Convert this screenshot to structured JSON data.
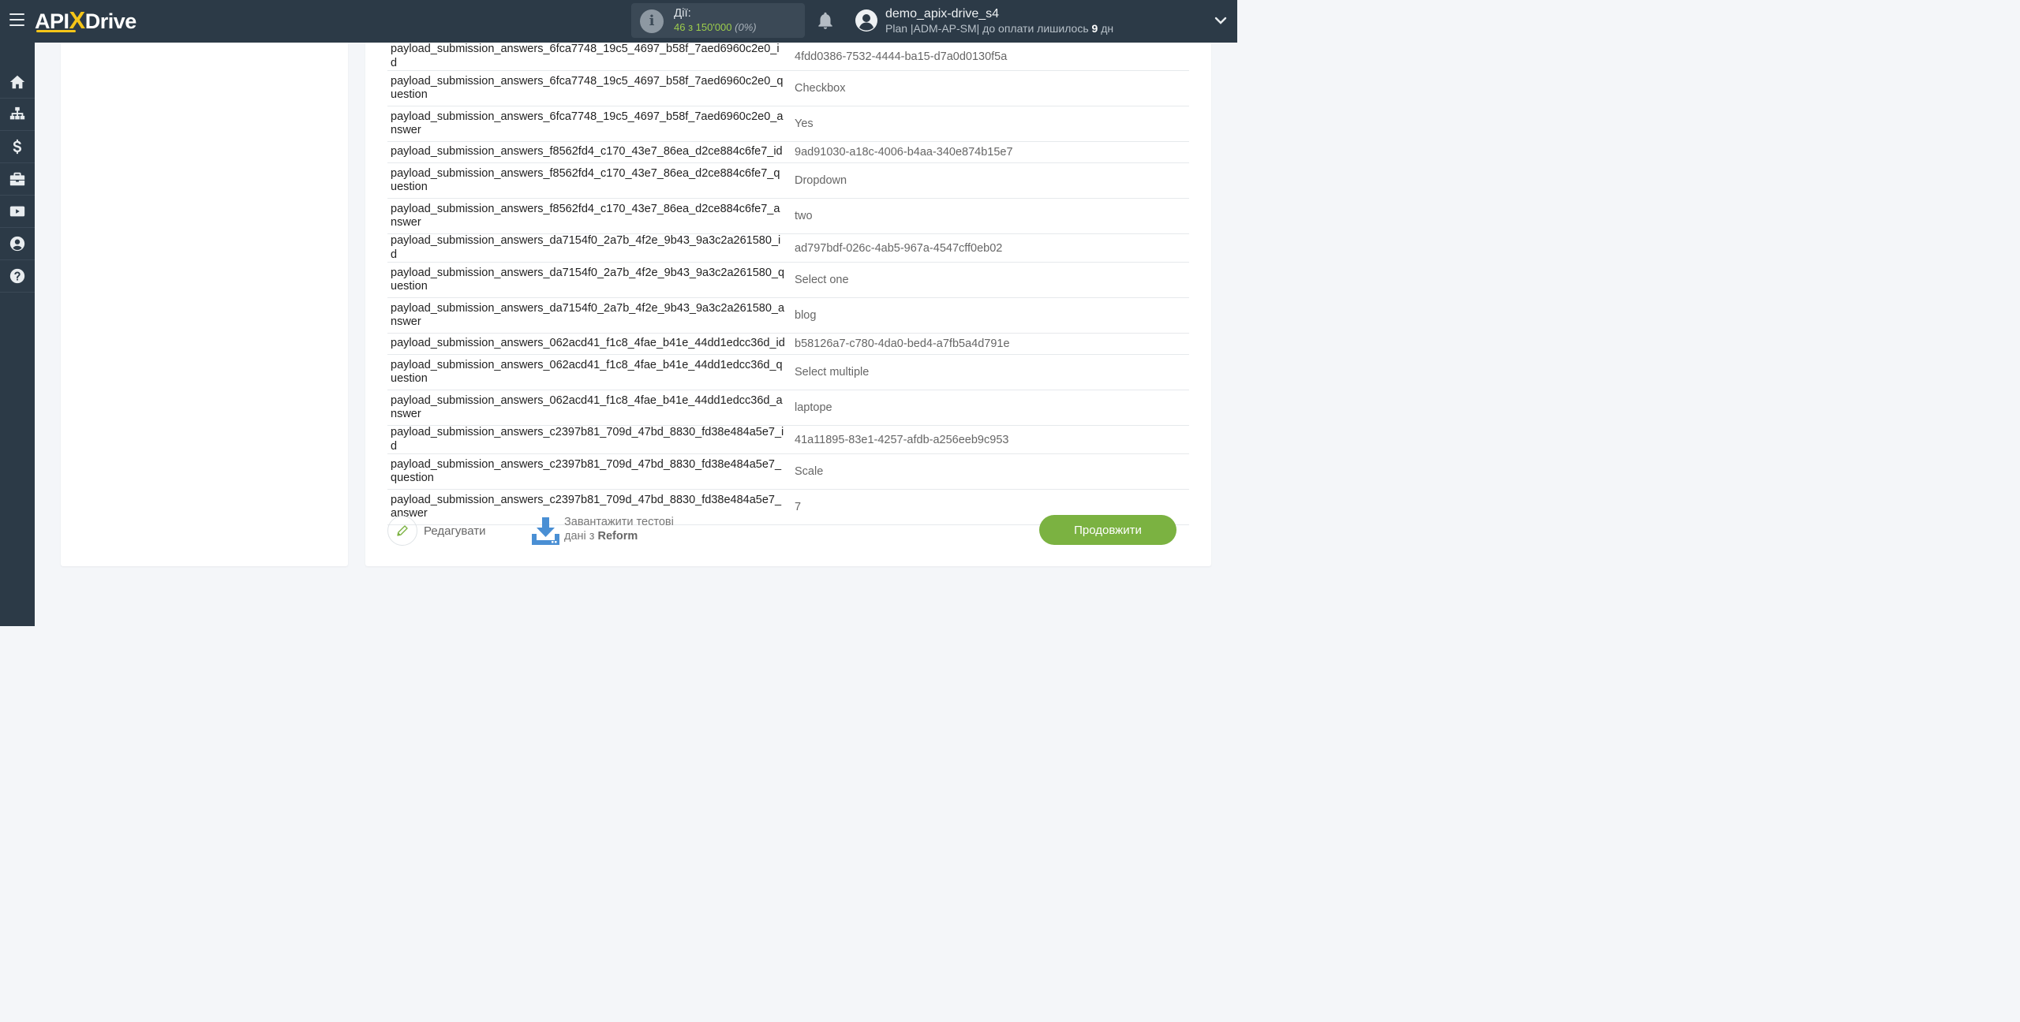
{
  "header": {
    "logo": {
      "left": "API",
      "x": "X",
      "right": "Drive"
    },
    "actions": {
      "label": "Дії:",
      "count": "46 з 150'000",
      "percent": "(0%)"
    },
    "user": {
      "name": "demo_apix-drive_s4",
      "plan_prefix": "Plan |ADM-AP-SM| до оплати лишилось ",
      "days": "9",
      "days_suffix": " дн"
    }
  },
  "sidebar": {
    "items": [
      "home-icon",
      "sitemap-icon",
      "dollar-icon",
      "briefcase-icon",
      "youtube-icon",
      "user-icon",
      "help-icon"
    ]
  },
  "table": {
    "rows": [
      {
        "key": "payload_submission_answers_6fca7748_19c5_4697_b58f_7aed6960c2e0_id",
        "value": "4fdd0386-7532-4444-ba15-d7a0d0130f5a"
      },
      {
        "key": "payload_submission_answers_6fca7748_19c5_4697_b58f_7aed6960c2e0_question",
        "value": "Checkbox"
      },
      {
        "key": "payload_submission_answers_6fca7748_19c5_4697_b58f_7aed6960c2e0_answer",
        "value": "Yes"
      },
      {
        "key": "payload_submission_answers_f8562fd4_c170_43e7_86ea_d2ce884c6fe7_id",
        "value": "9ad91030-a18c-4006-b4aa-340e874b15e7"
      },
      {
        "key": "payload_submission_answers_f8562fd4_c170_43e7_86ea_d2ce884c6fe7_question",
        "value": "Dropdown"
      },
      {
        "key": "payload_submission_answers_f8562fd4_c170_43e7_86ea_d2ce884c6fe7_answer",
        "value": "two"
      },
      {
        "key": "payload_submission_answers_da7154f0_2a7b_4f2e_9b43_9a3c2a261580_id",
        "value": "ad797bdf-026c-4ab5-967a-4547cff0eb02"
      },
      {
        "key": "payload_submission_answers_da7154f0_2a7b_4f2e_9b43_9a3c2a261580_question",
        "value": "Select one"
      },
      {
        "key": "payload_submission_answers_da7154f0_2a7b_4f2e_9b43_9a3c2a261580_answer",
        "value": "blog"
      },
      {
        "key": "payload_submission_answers_062acd41_f1c8_4fae_b41e_44dd1edcc36d_id",
        "value": "b58126a7-c780-4da0-bed4-a7fb5a4d791e"
      },
      {
        "key": "payload_submission_answers_062acd41_f1c8_4fae_b41e_44dd1edcc36d_question",
        "value": "Select multiple"
      },
      {
        "key": "payload_submission_answers_062acd41_f1c8_4fae_b41e_44dd1edcc36d_answer",
        "value": "laptope"
      },
      {
        "key": "payload_submission_answers_c2397b81_709d_47bd_8830_fd38e484a5e7_id",
        "value": "41a11895-83e1-4257-afdb-a256eeb9c953"
      },
      {
        "key": "payload_submission_answers_c2397b81_709d_47bd_8830_fd38e484a5e7_question",
        "value": "Scale"
      },
      {
        "key": "payload_submission_answers_c2397b81_709d_47bd_8830_fd38e484a5e7_answer",
        "value": "7"
      }
    ]
  },
  "footer": {
    "edit_label": "Редагувати",
    "download_line1": "Завантажити тестові",
    "download_line2_prefix": "дані з ",
    "download_source": "Reform",
    "continue_label": "Продовжити"
  },
  "colors": {
    "topbar": "#2c3a47",
    "accent_green": "#7bb241",
    "logo_x": "#f5c518",
    "download_icon": "#4a8fd4"
  }
}
